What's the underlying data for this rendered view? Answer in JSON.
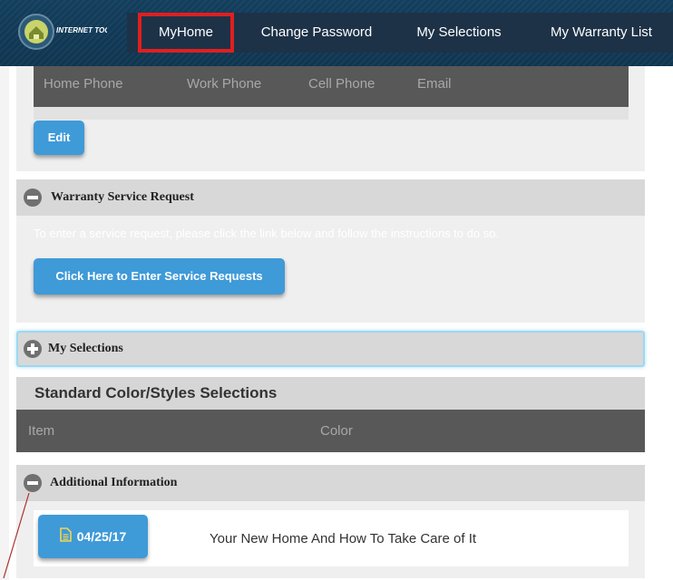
{
  "nav": {
    "items": [
      "MyHome",
      "Change Password",
      "My Selections",
      "My Warranty List"
    ],
    "active": "MyHome",
    "highlight_color": "#e01f1f"
  },
  "logo": {
    "text": "INTERNET TOOLKIT"
  },
  "contact": {
    "columns": [
      "Home Phone",
      "Work Phone",
      "Cell Phone",
      "Email"
    ],
    "edit_label": "Edit"
  },
  "warranty": {
    "title": "Warranty Service Request",
    "instructions": "To enter a service request, please click the link below and follow the instructions to do so.",
    "button_label": "Click Here to Enter Service Requests",
    "icon": "minus-icon"
  },
  "selections": {
    "title": "My Selections",
    "icon": "plus-icon"
  },
  "standard": {
    "title": "Standard Color/Styles Selections",
    "columns": [
      "Item",
      "Color"
    ]
  },
  "additional": {
    "title": "Additional Information",
    "icon": "minus-icon",
    "documents": [
      {
        "date": "04/25/17",
        "title": "Your New Home And How To Take Care of It",
        "icon": "document-icon"
      }
    ]
  },
  "colors": {
    "accent_blue": "#3f9ad8",
    "nav_bg": "#1d3247",
    "header_dark": "#585858",
    "section_gray": "#d8d8d8",
    "panel_gray": "#efefef"
  }
}
